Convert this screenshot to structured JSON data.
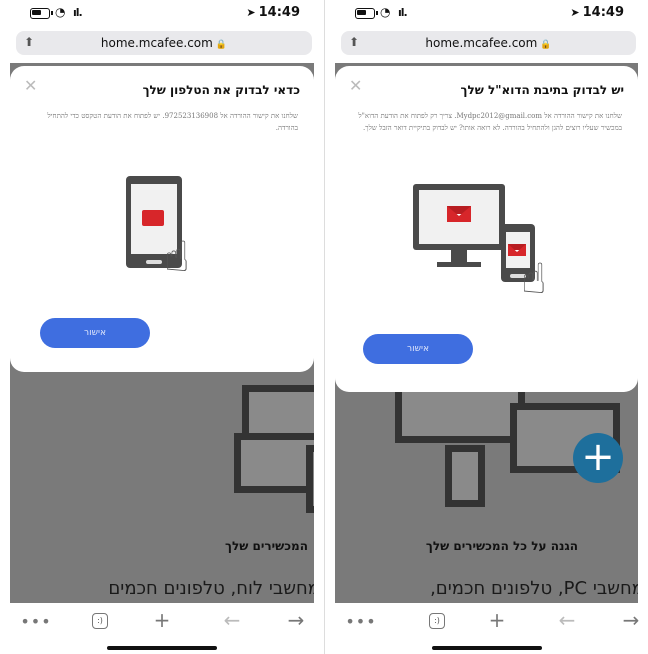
{
  "screens": [
    {
      "status": {
        "time": "14:49"
      },
      "url": "home.mcafee.com",
      "modal": {
        "title": "כדאי לבדוק את הטלפון שלך",
        "body": "שלחנו את קישור ההורדה אל 972523136908. יש לפתוח את הודעת הטקסט כדי להתחיל בהורדה.",
        "button": "אישור"
      },
      "background": {
        "heading": "המכשירים שלך",
        "text": "מחשבי לוח, טלפונים חכמים"
      }
    },
    {
      "status": {
        "time": "14:49"
      },
      "url": "home.mcafee.com",
      "modal": {
        "title": "יש לבדוק בתיבת הדוא\"ל שלך",
        "body": "שלחנו את קישור ההורדה אל Mydpc2012@gmail.com. צריך רק לפתוח את הודעת הדוא\"ל במכשיר שעליו רוצים להגן ולהתחיל בהורדה. לא רואה אותו? יש לבדוק בתיקיית דואר הזבל שלך.",
        "button": "אישור"
      },
      "background": {
        "heading": "הגנה על כל המכשירים שלך",
        "text": "מחשבי PC, טלפונים חכמים,"
      }
    }
  ],
  "colors": {
    "accent": "#3f6ee0",
    "mail_red": "#d7262a",
    "plus_blue": "#1e6f9c"
  }
}
